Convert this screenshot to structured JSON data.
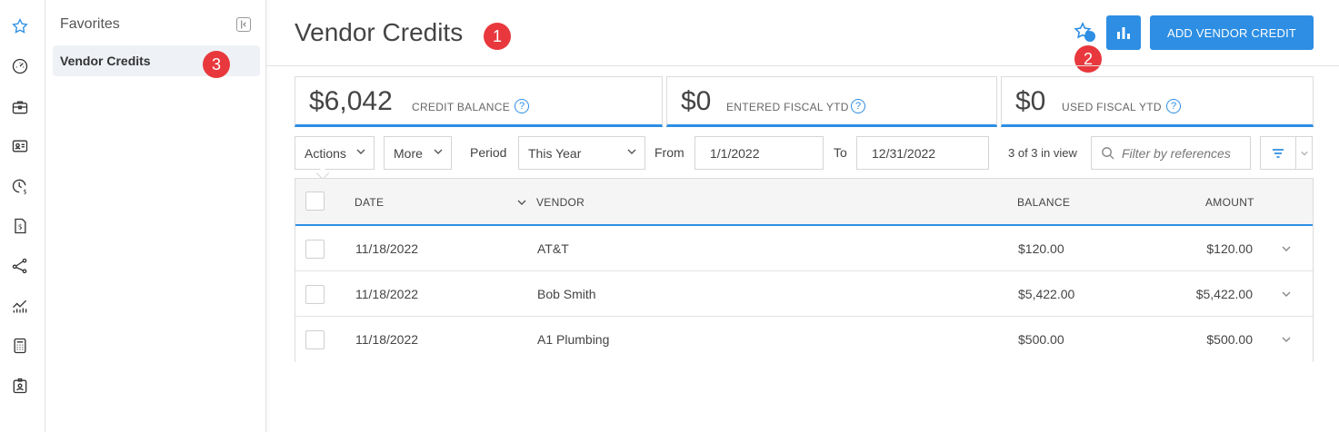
{
  "favorites": {
    "title": "Favorites",
    "collapse_icon": "collapse-left-icon",
    "items": [
      {
        "label": "Vendor Credits"
      }
    ]
  },
  "rail": {
    "icons": [
      "star-icon",
      "dashboard-icon",
      "briefcase-icon",
      "contact-card-icon",
      "time-billing-icon",
      "invoice-icon",
      "workflow-icon",
      "reports-chart-icon",
      "calculator-icon",
      "badge-user-icon"
    ]
  },
  "header": {
    "title": "Vendor Credits",
    "add_button_label": "ADD VENDOR CREDIT"
  },
  "annotations": [
    "1",
    "2",
    "3"
  ],
  "summary": [
    {
      "value": "$6,042",
      "label": "CREDIT BALANCE"
    },
    {
      "value": "$0",
      "label": "ENTERED FISCAL YTD"
    },
    {
      "value": "$0",
      "label": "USED FISCAL YTD"
    }
  ],
  "help_glyph": "?",
  "filters": {
    "actions_label": "Actions",
    "more_label": "More",
    "period_label": "Period",
    "period_value": "This Year",
    "from_label": "From",
    "from_value": "1/1/2022",
    "to_label": "To",
    "to_value": "12/31/2022",
    "view_count": "3 of 3 in view",
    "search_placeholder": "Filter by references"
  },
  "table": {
    "columns": {
      "date": "DATE",
      "vendor": "VENDOR",
      "balance": "BALANCE",
      "amount": "AMOUNT"
    },
    "rows": [
      {
        "date": "11/18/2022",
        "vendor": "AT&T",
        "balance": "$120.00",
        "amount": "$120.00"
      },
      {
        "date": "11/18/2022",
        "vendor": "Bob Smith",
        "balance": "$5,422.00",
        "amount": "$5,422.00"
      },
      {
        "date": "11/18/2022",
        "vendor": "A1 Plumbing",
        "balance": "$500.00",
        "amount": "$500.00"
      }
    ]
  },
  "colors": {
    "accent": "#2d8ee3",
    "badge": "#e8383d"
  }
}
